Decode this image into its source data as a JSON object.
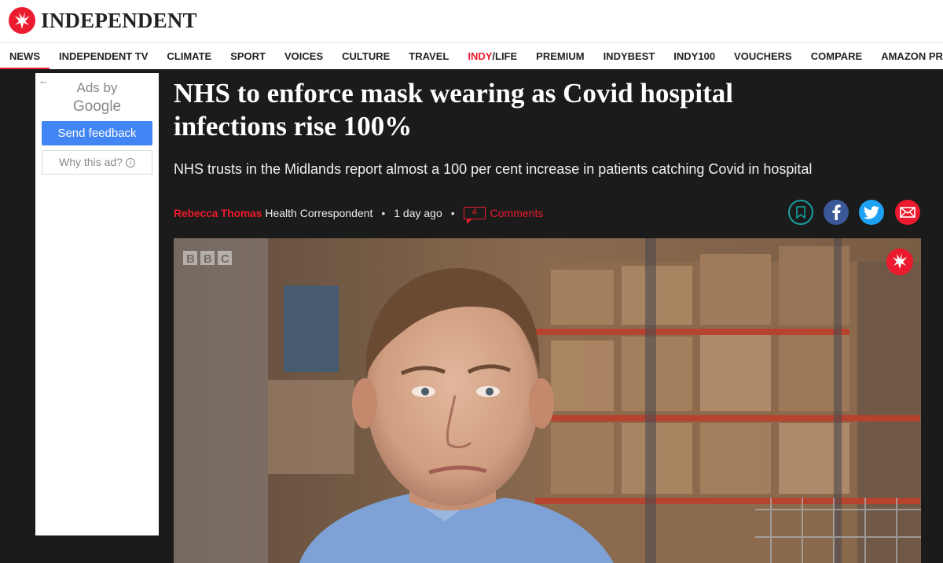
{
  "brand": {
    "name": "INDEPENDENT"
  },
  "nav": {
    "items": [
      {
        "label": "NEWS",
        "active": true
      },
      {
        "label": "INDEPENDENT TV"
      },
      {
        "label": "CLIMATE"
      },
      {
        "label": "SPORT"
      },
      {
        "label": "VOICES"
      },
      {
        "label": "CULTURE"
      },
      {
        "label": "TRAVEL"
      },
      {
        "label": "PREMIUM"
      },
      {
        "label": "INDYBEST"
      },
      {
        "label": "INDY100"
      },
      {
        "label": "VOUCHERS"
      },
      {
        "label": "COMPARE"
      },
      {
        "label": "AMAZON PRIME DAY"
      }
    ],
    "indy_life": {
      "indy": "INDY",
      "life": "/LIFE"
    }
  },
  "ad": {
    "back_icon": "arrow-left-icon",
    "ads_by": "Ads by",
    "google": "Google",
    "send_feedback": "Send feedback",
    "why_this_ad": "Why this ad?",
    "info_icon": "info-icon"
  },
  "article": {
    "headline_line1": "NHS to enforce mask wearing as Covid hospital",
    "headline_line2": "infections rise 100%",
    "standfirst": "NHS trusts in the Midlands report almost a 100 per cent increase in patients catching Covid in hospital",
    "author": "Rebecca Thomas",
    "role": "Health Correspondent",
    "time": "1 day ago",
    "comment_count": "4",
    "comments_label": "Comments"
  },
  "video": {
    "watermark": "BBC"
  },
  "colors": {
    "brand_red": "#ec1a2e",
    "dark_bg": "#1b1b1b",
    "facebook": "#3b5998",
    "twitter": "#1da1f2",
    "save_teal": "#1aa0a0",
    "google_blue": "#4285f4"
  }
}
